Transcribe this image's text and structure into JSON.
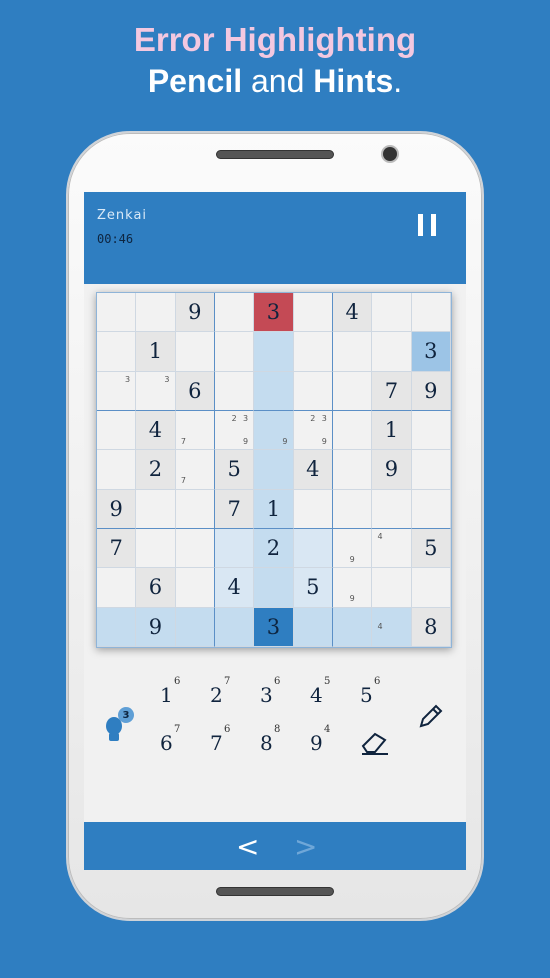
{
  "headline": {
    "line1": "Error Highlighting",
    "line2_a": "Pencil",
    "line2_b": "and",
    "line2_c": "Hints",
    "line2_d": "."
  },
  "app": {
    "title": "Zenkai",
    "timer": "00:46"
  },
  "board": [
    [
      "",
      "",
      "9",
      "",
      "3",
      "",
      "4",
      "",
      ""
    ],
    [
      "",
      "1",
      "",
      "",
      "",
      "",
      "",
      "",
      "3"
    ],
    [
      "",
      "",
      "6",
      "",
      "",
      "",
      "",
      "7",
      "9"
    ],
    [
      "",
      "4",
      "",
      "",
      "",
      "",
      "",
      "1",
      ""
    ],
    [
      "",
      "2",
      "",
      "5",
      "",
      "4",
      "",
      "9",
      ""
    ],
    [
      "9",
      "",
      "",
      "7",
      "1",
      "",
      "",
      "",
      ""
    ],
    [
      "7",
      "",
      "",
      "",
      "2",
      "",
      "",
      "",
      "5"
    ],
    [
      "",
      "6",
      "",
      "4",
      "",
      "5",
      "",
      "",
      ""
    ],
    [
      "",
      "9",
      "",
      "",
      "3",
      "",
      "",
      "",
      "8"
    ]
  ],
  "pencil_marks": {
    "2-0": [
      "",
      "",
      "3",
      "",
      "",
      "",
      "",
      "",
      ""
    ],
    "2-1": [
      "",
      "",
      "3",
      "",
      "",
      "",
      "",
      "",
      ""
    ],
    "3-2": [
      "",
      "",
      "",
      "",
      "",
      "",
      "7",
      "",
      ""
    ],
    "3-3": [
      "",
      "2",
      "3",
      "",
      "",
      "",
      "",
      "",
      "9"
    ],
    "3-4": [
      "",
      "",
      "",
      "",
      "",
      "",
      "",
      "",
      "9"
    ],
    "3-5": [
      "",
      "2",
      "3",
      "",
      "",
      "",
      "",
      "",
      "9"
    ],
    "4-2": [
      "",
      "",
      "",
      "",
      "",
      "",
      "7",
      "",
      ""
    ],
    "6-6": [
      "",
      "",
      "",
      "",
      "",
      "",
      "",
      "9",
      ""
    ],
    "6-7": [
      "4",
      "",
      "",
      "",
      "",
      "",
      "",
      "",
      ""
    ],
    "7-6": [
      "",
      "",
      "",
      "",
      "",
      "",
      "",
      "9",
      ""
    ],
    "8-7": [
      "",
      "",
      "",
      "4",
      "",
      "",
      "",
      "",
      ""
    ]
  },
  "hints": {
    "count": "3"
  },
  "keypad": [
    {
      "digit": "1",
      "remaining": "6"
    },
    {
      "digit": "2",
      "remaining": "7"
    },
    {
      "digit": "3",
      "remaining": "6"
    },
    {
      "digit": "4",
      "remaining": "5"
    },
    {
      "digit": "5",
      "remaining": "6"
    },
    {
      "digit": "6",
      "remaining": "7"
    },
    {
      "digit": "7",
      "remaining": "6"
    },
    {
      "digit": "8",
      "remaining": "8"
    },
    {
      "digit": "9",
      "remaining": "4"
    }
  ],
  "nav": {
    "prev": "<",
    "next": ">"
  },
  "colors": {
    "accent": "#2f7ec1",
    "error": "#c44a55",
    "headline_pink": "#f3c8e0"
  }
}
